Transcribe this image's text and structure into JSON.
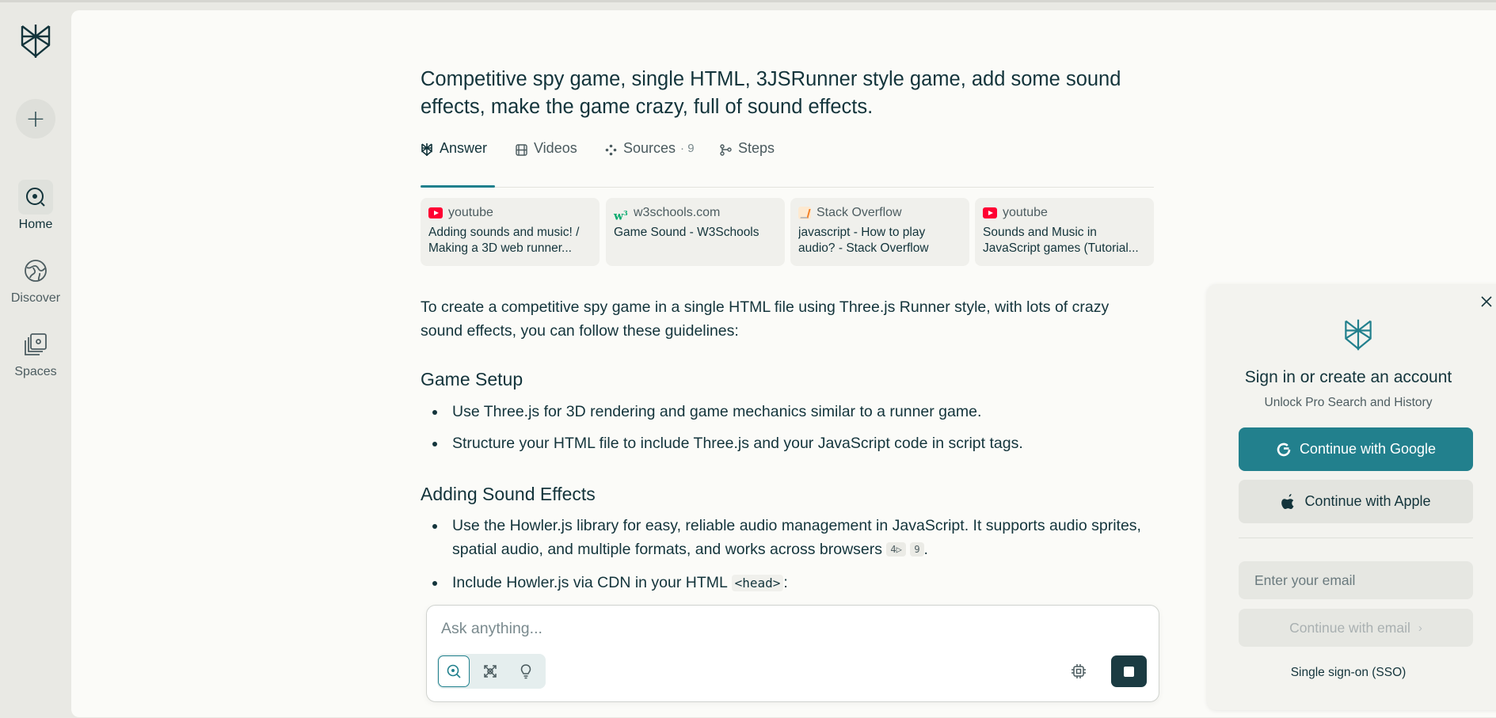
{
  "sidebar": {
    "logo": "perplexity-logo",
    "new_thread_icon": "plus-icon",
    "items": [
      {
        "label": "Home",
        "icon": "search-circle-icon",
        "active": true
      },
      {
        "label": "Discover",
        "icon": "globe-icon",
        "active": false
      },
      {
        "label": "Spaces",
        "icon": "stacked-squares-icon",
        "active": false
      }
    ]
  },
  "thread": {
    "title": "Competitive spy game, single HTML, 3JSRunner style game, add some sound effects, make the game crazy, full of sound effects."
  },
  "tabs": [
    {
      "label": "Answer",
      "icon": "perplexity-icon",
      "active": true
    },
    {
      "label": "Videos",
      "icon": "film-icon"
    },
    {
      "label": "Sources",
      "count": "· 9",
      "icon": "sources-icon"
    },
    {
      "label": "Steps",
      "icon": "branch-icon"
    }
  ],
  "sources": [
    {
      "site": "youtube",
      "favicon": "youtube-icon",
      "title": "Adding sounds and music! / Making a 3D web runner..."
    },
    {
      "site": "w3schools.com",
      "favicon": "w3schools-icon",
      "title": "Game Sound - W3Schools"
    },
    {
      "site": "Stack Overflow",
      "favicon": "stackoverflow-icon",
      "title": "javascript - How to play audio? - Stack Overflow"
    },
    {
      "site": "youtube",
      "favicon": "youtube-icon",
      "title": "Sounds and Music in JavaScript games (Tutorial..."
    }
  ],
  "answer": {
    "intro": "To create a competitive spy game in a single HTML file using Three.js Runner style, with lots of crazy sound effects, you can follow these guidelines:",
    "section1": {
      "heading": "Game Setup",
      "bullets": [
        "Use Three.js for 3D rendering and game mechanics similar to a runner game.",
        "Structure your HTML file to include Three.js and your JavaScript code in script tags."
      ]
    },
    "section2": {
      "heading": "Adding Sound Effects",
      "bullet1": "Use the Howler.js library for easy, reliable audio management in JavaScript. It supports audio sprites, spatial audio, and multiple formats, and works across browsers",
      "cite1": "4",
      "cite2": "9",
      "bullet2_prefix": "Include Howler.js via CDN in your HTML",
      "bullet2_code": "<head>",
      "bullet2_suffix": ":"
    }
  },
  "ask": {
    "placeholder": "Ask anything...",
    "modes": [
      "search-icon",
      "pro-search-icon",
      "reasoning-bulb-icon"
    ],
    "model_icon": "cpu-icon",
    "stop_icon": "stop-icon"
  },
  "signin": {
    "title": "Sign in or create an account",
    "subtitle": "Unlock Pro Search and History",
    "google_label": "Continue with Google",
    "apple_label": "Continue with Apple",
    "email_placeholder": "Enter your email",
    "continue_email_label": "Continue with email",
    "sso_label": "Single sign-on (SSO)",
    "colors": {
      "primary": "#22808d",
      "text": "#13343b"
    }
  }
}
